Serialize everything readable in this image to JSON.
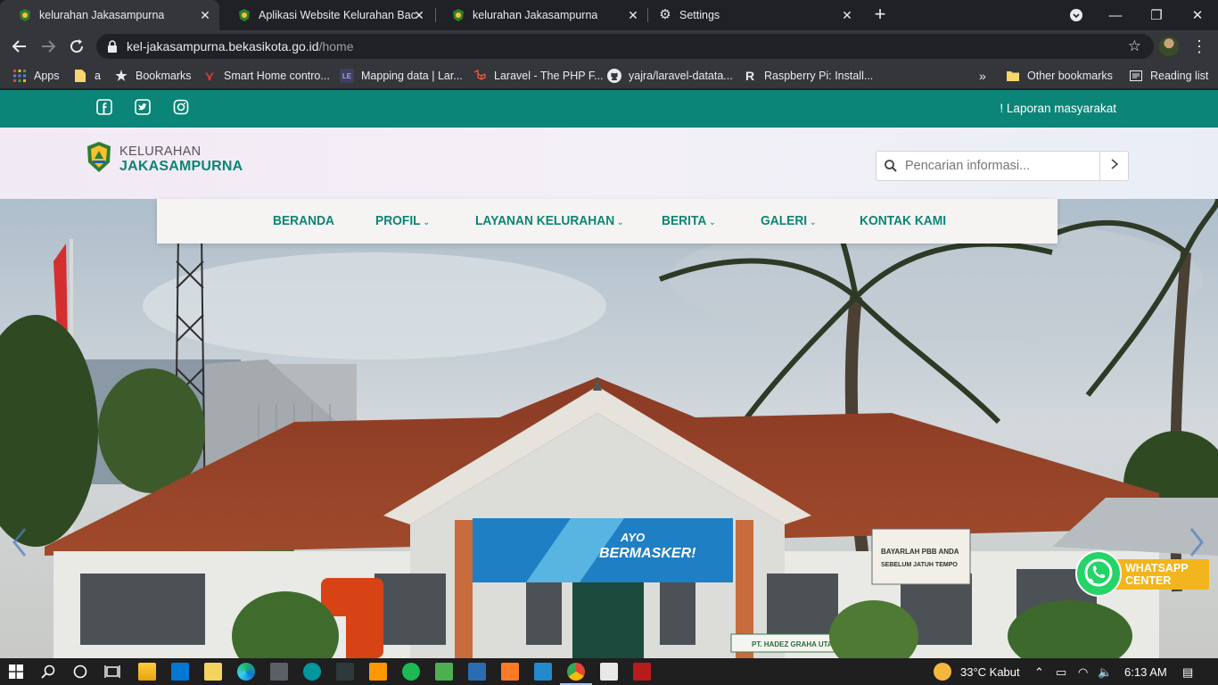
{
  "browser": {
    "tabs": [
      {
        "title": "kelurahan Jakasampurna",
        "active": true
      },
      {
        "title": "Aplikasi Website Kelurahan Backend",
        "active": false
      },
      {
        "title": "kelurahan Jakasampurna",
        "active": false
      },
      {
        "title": "Settings",
        "active": false
      }
    ],
    "url_domain": "kel-jakasampurna.bekasikota.go.id",
    "url_path": "/home",
    "bookmarks": [
      "Apps",
      "a",
      "Bookmarks",
      "Smart Home contro...",
      "Mapping data | Lar...",
      "Laravel - The PHP F...",
      "yajra/laravel-datata...",
      "Raspberry Pi: Install..."
    ],
    "bookmarks_overflow": "»",
    "other_bookmarks": "Other bookmarks",
    "reading_list": "Reading list"
  },
  "site": {
    "topbar": {
      "laporan": "! Laporan masyarakat",
      "socials": [
        "facebook",
        "twitter",
        "instagram"
      ]
    },
    "logo": {
      "top": "KELURAHAN",
      "bottom": "JAKASAMPURNA"
    },
    "search": {
      "placeholder": "Pencarian informasi..."
    },
    "nav": [
      {
        "label": "BERANDA",
        "caret": ""
      },
      {
        "label": "PROFIL",
        "caret": "⌄"
      },
      {
        "label": "LAYANAN KELURAHAN",
        "caret": "⌄"
      },
      {
        "label": "BERITA",
        "caret": "⌄"
      },
      {
        "label": "GALERI",
        "caret": "⌄"
      },
      {
        "label": "KONTAK KAMI",
        "caret": ""
      }
    ],
    "hero": {
      "banner_line1": "AYO",
      "banner_line2": "BERMASKER!",
      "sign1": "PT. HADEZ GRAHA UTAMA",
      "sign2_line1": "BAYARLAH PBB ANDA",
      "sign2_line2": "SEBELUM JATUH TEMPO"
    },
    "whatsapp": {
      "line1": "WHATSAPP",
      "line2": "CENTER"
    }
  },
  "taskbar": {
    "weather": "33°C  Kabut",
    "time": "6:13 AM"
  },
  "colors": {
    "brand_teal": "#0b8577",
    "whatsapp_green": "#25d366",
    "whatsapp_label": "#f2b51e"
  }
}
